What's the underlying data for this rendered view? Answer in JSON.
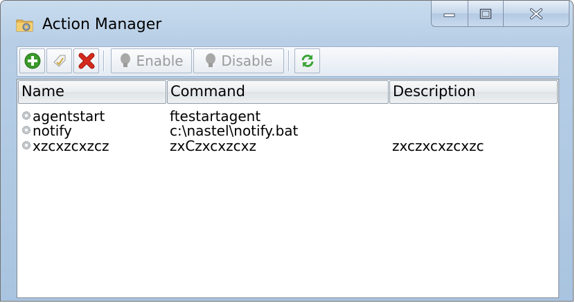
{
  "window": {
    "title": "Action Manager"
  },
  "toolbar": {
    "add_icon": "add-icon",
    "edit_icon": "edit-icon",
    "delete_icon": "delete-icon",
    "enable_label": "Enable",
    "disable_label": "Disable",
    "refresh_icon": "refresh-icon"
  },
  "table": {
    "columns": [
      "Name",
      "Command",
      "Description"
    ],
    "rows": [
      {
        "name": "agentstart",
        "command": "ftestartagent",
        "description": ""
      },
      {
        "name": "notify",
        "command": "c:\\nastel\\notify.bat",
        "description": ""
      },
      {
        "name": "xzcxzcxzcz",
        "command": "zxCzxcxzcxz",
        "description": "zxczxcxzcxzc"
      }
    ]
  },
  "colors": {
    "add": "#3a9a2b",
    "delete": "#d42a1e",
    "refresh": "#3aa536",
    "titlebar": "#b7cee6"
  }
}
